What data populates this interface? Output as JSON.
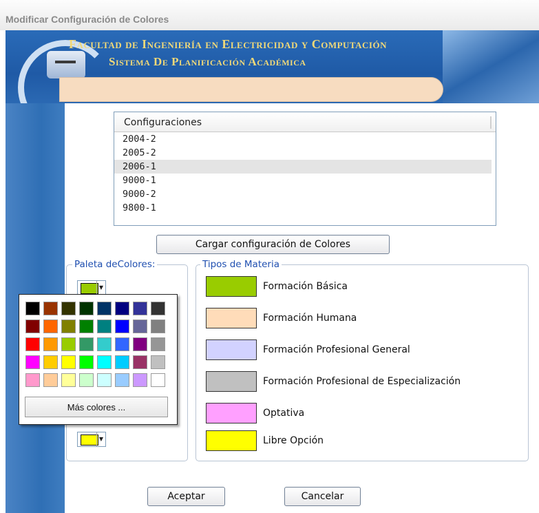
{
  "window": {
    "title": "Modificar Configuración de Colores"
  },
  "header": {
    "line1": "Facultad de Ingeniería en Electricidad y Computación",
    "line2": "Sistema De Planificación Académica"
  },
  "configuraciones": {
    "header": "Configuraciones",
    "items": [
      "2004-2",
      "2005-2",
      "2006-1",
      "9000-1",
      "9000-2",
      "9800-1"
    ],
    "selected": "2006-1"
  },
  "load_button": "Cargar configuración de Colores",
  "palette": {
    "legend": "Paleta deColores:",
    "top_color": "#99cc00",
    "bottom_color": "#ffff00",
    "popup": {
      "colors": [
        [
          "#000000",
          "#993300",
          "#333300",
          "#003300",
          "#003366",
          "#000080",
          "#333399",
          "#333333"
        ],
        [
          "#800000",
          "#ff6600",
          "#808000",
          "#008000",
          "#008080",
          "#0000ff",
          "#666699",
          "#808080"
        ],
        [
          "#ff0000",
          "#ff9900",
          "#99cc00",
          "#339966",
          "#33cccc",
          "#3366ff",
          "#800080",
          "#969696"
        ],
        [
          "#ff00ff",
          "#ffcc00",
          "#ffff00",
          "#00ff00",
          "#00ffff",
          "#00ccff",
          "#993366",
          "#c0c0c0"
        ],
        [
          "#ff99cc",
          "#ffcc99",
          "#ffff99",
          "#ccffcc",
          "#ccffff",
          "#99ccff",
          "#cc99ff",
          "#ffffff"
        ]
      ],
      "more_label": "Más colores ..."
    }
  },
  "materias": {
    "legend": "Tipos de Materia",
    "items": [
      {
        "label": "Formación Básica",
        "color": "#99cc00"
      },
      {
        "label": "Formación Humana",
        "color": "#ffdcb9"
      },
      {
        "label": "Formación Profesional General",
        "color": "#d2d2ff"
      },
      {
        "label": "Formación Profesional de Especialización",
        "color": "#c0c0c0"
      },
      {
        "label": "Optativa",
        "color": "#ffa0ff"
      },
      {
        "label": "Libre Opción",
        "color": "#ffff00"
      }
    ]
  },
  "footer": {
    "accept": "Aceptar",
    "cancel": "Cancelar"
  }
}
